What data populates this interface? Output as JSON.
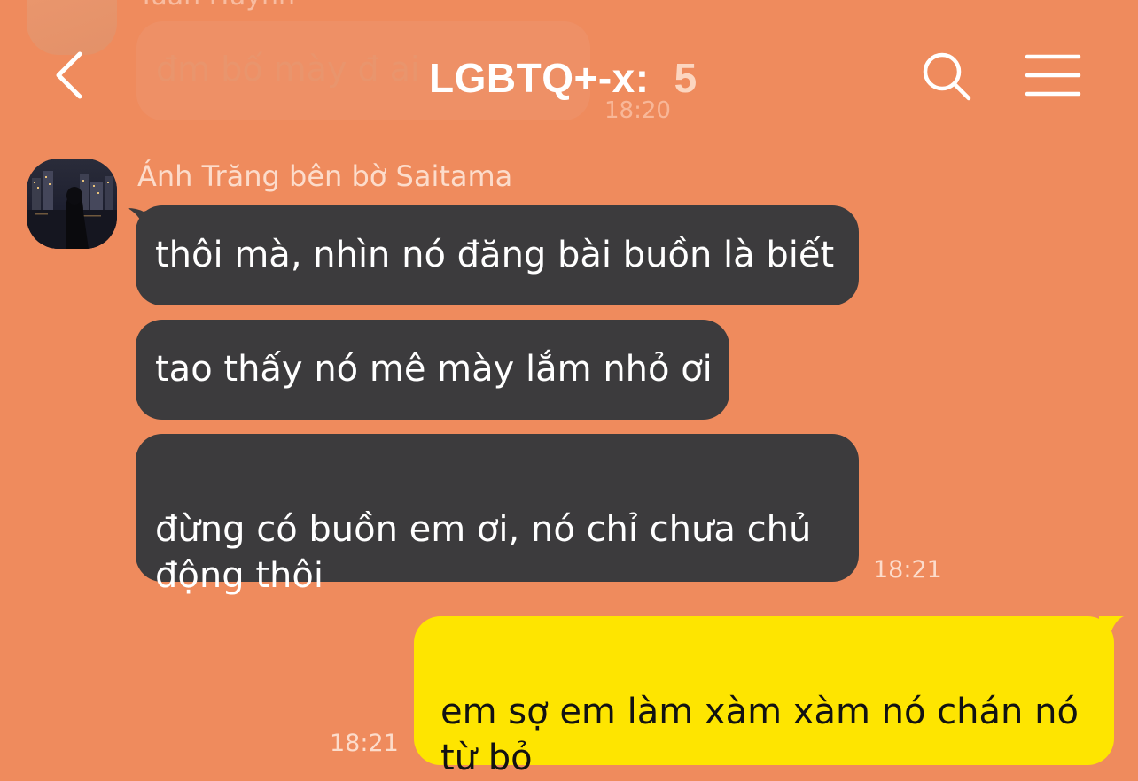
{
  "header": {
    "title": "LGBTQ+-x:",
    "member_count": "5"
  },
  "previous_message": {
    "sender": "Tuấn Huỳnh",
    "text": "đm bố mày đ ai",
    "time": "18:20"
  },
  "incoming_group": {
    "sender": "Ánh Trăng bên bờ Saitama",
    "messages": [
      "thôi mà, nhìn nó đăng bài buồn là biết",
      "tao thấy nó mê mày lắm nhỏ ơi",
      "đừng có buồn em ơi, nó chỉ chưa chủ\nđộng thôi"
    ],
    "time": "18:21"
  },
  "outgoing": {
    "text": "em sợ em làm xàm xàm nó chán nó\ntừ bỏ",
    "time": "18:21"
  },
  "colors": {
    "background": "#EF8B5D",
    "incoming_bubble": "#3C3B3D",
    "outgoing_bubble": "#FEE500",
    "meta_text": "#FCDCCB"
  },
  "icons": {
    "back": "chevron-left-icon",
    "search": "search-icon",
    "menu": "hamburger-menu-icon"
  }
}
